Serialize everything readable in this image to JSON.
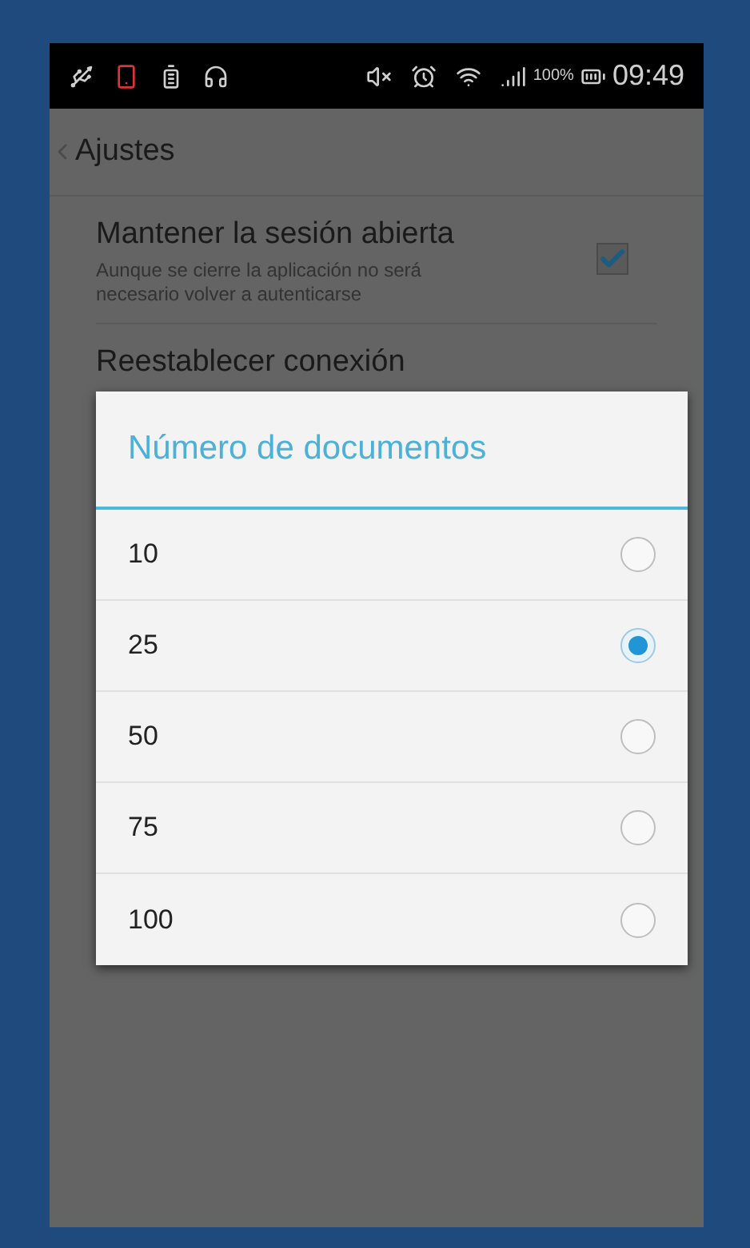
{
  "status_bar": {
    "battery_percent": "100%",
    "time": "09:49"
  },
  "action_bar": {
    "title": "Ajustes"
  },
  "settings": [
    {
      "kind": "checkbox",
      "title": "Mantener la sesión abierta",
      "summary": "Aunque se cierre la aplicación no será necesario volver a autenticarse",
      "checked": true
    },
    {
      "kind": "plain",
      "title": "Reestablecer conexión"
    }
  ],
  "dialog": {
    "title": "Número de documentos",
    "options": [
      {
        "label": "10",
        "selected": false
      },
      {
        "label": "25",
        "selected": true
      },
      {
        "label": "50",
        "selected": false
      },
      {
        "label": "75",
        "selected": false
      },
      {
        "label": "100",
        "selected": false
      }
    ]
  }
}
